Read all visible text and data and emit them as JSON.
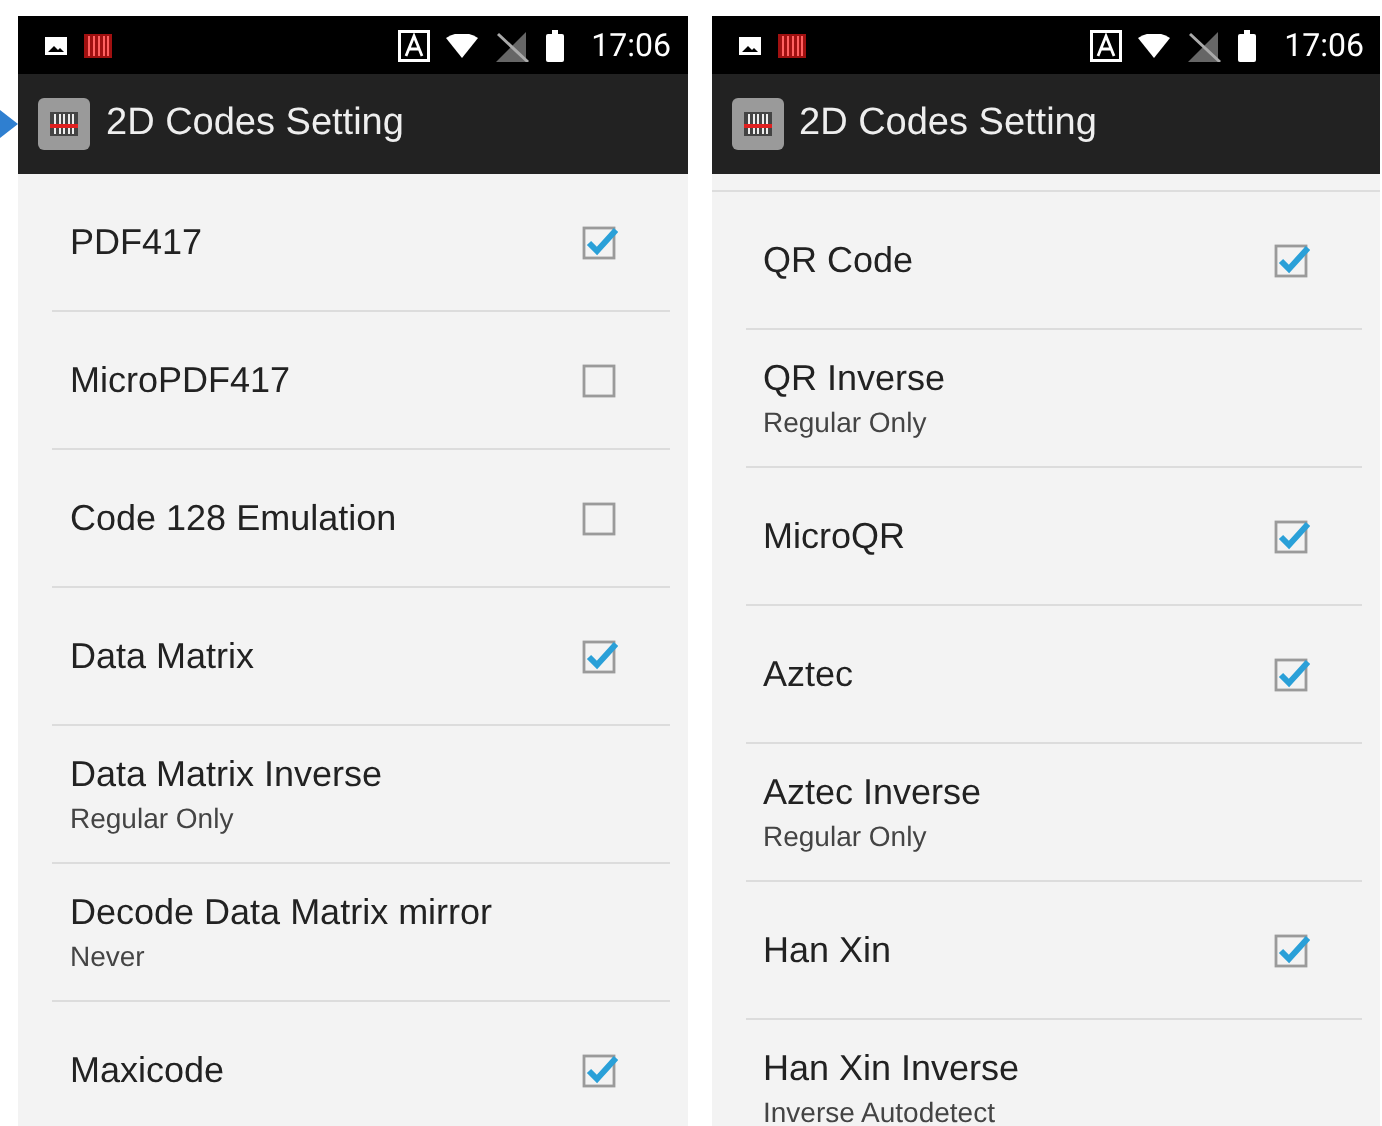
{
  "screens": [
    {
      "status_bar": {
        "time": "17:06"
      },
      "app_bar": {
        "title": "2D Codes Setting"
      },
      "items": [
        {
          "kind": "checkbox",
          "label": "PDF417",
          "checked": true
        },
        {
          "kind": "checkbox",
          "label": "MicroPDF417",
          "checked": false
        },
        {
          "kind": "checkbox",
          "label": "Code 128 Emulation",
          "checked": false
        },
        {
          "kind": "checkbox",
          "label": "Data Matrix",
          "checked": true
        },
        {
          "kind": "option",
          "label": "Data Matrix Inverse",
          "summary": "Regular Only"
        },
        {
          "kind": "option",
          "label": "Decode Data Matrix mirror",
          "summary": "Never"
        },
        {
          "kind": "checkbox",
          "label": "Maxicode",
          "checked": true
        }
      ]
    },
    {
      "status_bar": {
        "time": "17:06"
      },
      "app_bar": {
        "title": "2D Codes Setting"
      },
      "items": [
        {
          "kind": "checkbox",
          "label": "QR Code",
          "checked": true
        },
        {
          "kind": "option",
          "label": "QR Inverse",
          "summary": "Regular Only"
        },
        {
          "kind": "checkbox",
          "label": "MicroQR",
          "checked": true
        },
        {
          "kind": "checkbox",
          "label": "Aztec",
          "checked": true
        },
        {
          "kind": "option",
          "label": "Aztec Inverse",
          "summary": "Regular Only"
        },
        {
          "kind": "checkbox",
          "label": "Han Xin",
          "checked": true
        },
        {
          "kind": "option",
          "label": "Han Xin Inverse",
          "summary": "Inverse Autodetect"
        }
      ]
    }
  ]
}
